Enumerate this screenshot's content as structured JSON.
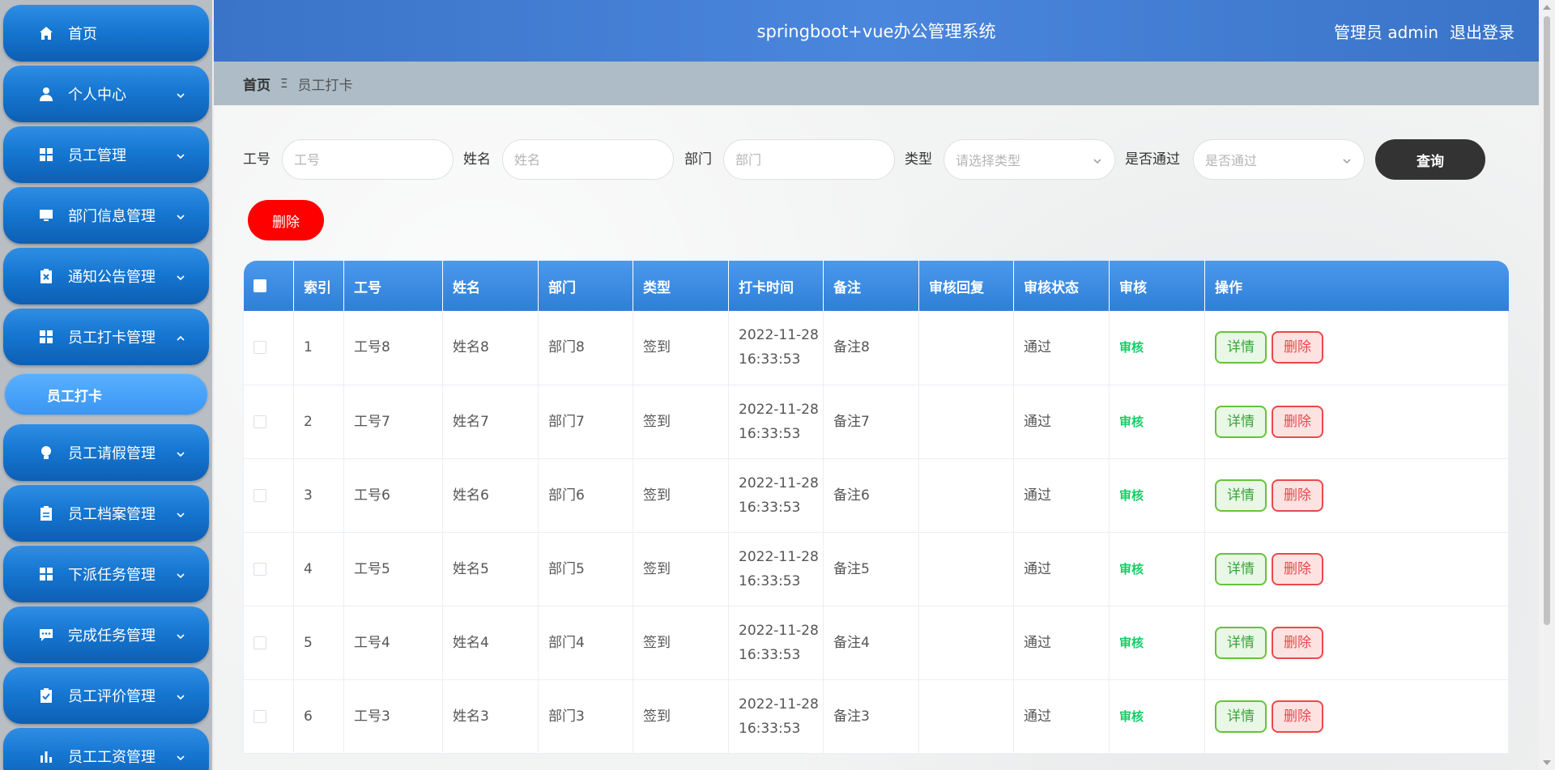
{
  "sidebar": {
    "items": [
      {
        "label": "首页",
        "icon": "home-icon",
        "has_arrow": false
      },
      {
        "label": "个人中心",
        "icon": "user-icon",
        "has_arrow": true,
        "arrow": "chevron-down"
      },
      {
        "label": "员工管理",
        "icon": "grid-icon",
        "has_arrow": true,
        "arrow": "chevron-down"
      },
      {
        "label": "部门信息管理",
        "icon": "monitor-icon",
        "has_arrow": true,
        "arrow": "chevron-down"
      },
      {
        "label": "通知公告管理",
        "icon": "clipboard-x-icon",
        "has_arrow": true,
        "arrow": "chevron-down"
      },
      {
        "label": "员工打卡管理",
        "icon": "grid-icon",
        "has_arrow": true,
        "arrow": "chevron-up"
      },
      {
        "label": "员工请假管理",
        "icon": "lightbulb-icon",
        "has_arrow": true,
        "arrow": "chevron-down"
      },
      {
        "label": "员工档案管理",
        "icon": "clipboard-icon",
        "has_arrow": true,
        "arrow": "chevron-down"
      },
      {
        "label": "下派任务管理",
        "icon": "grid-icon",
        "has_arrow": true,
        "arrow": "chevron-down"
      },
      {
        "label": "完成任务管理",
        "icon": "chat-icon",
        "has_arrow": true,
        "arrow": "chevron-down"
      },
      {
        "label": "员工评价管理",
        "icon": "clipboard-check-icon",
        "has_arrow": true,
        "arrow": "chevron-down"
      },
      {
        "label": "员工工资管理",
        "icon": "bar-chart-icon",
        "has_arrow": true,
        "arrow": "chevron-down"
      }
    ],
    "active_sub": "员工打卡"
  },
  "header": {
    "title": "springboot+vue办公管理系统",
    "user_role": "管理员 admin",
    "logout": "退出登录"
  },
  "breadcrumb": {
    "home": "首页",
    "separator": "Ξ",
    "current": "员工打卡"
  },
  "search": {
    "emp_no_label": "工号",
    "emp_no_placeholder": "工号",
    "name_label": "姓名",
    "name_placeholder": "姓名",
    "dept_label": "部门",
    "dept_placeholder": "部门",
    "type_label": "类型",
    "type_placeholder": "请选择类型",
    "passed_label": "是否通过",
    "passed_placeholder": "是否通过",
    "query_button": "查询"
  },
  "actions": {
    "delete_button": "删除"
  },
  "table": {
    "columns": [
      "",
      "索引",
      "工号",
      "姓名",
      "部门",
      "类型",
      "打卡时间",
      "备注",
      "审核回复",
      "审核状态",
      "审核",
      "操作"
    ],
    "rows": [
      {
        "index": "1",
        "emp_no": "工号8",
        "name": "姓名8",
        "dept": "部门8",
        "type": "签到",
        "date": "2022-11-28",
        "time": "16:33:53",
        "remark": "备注8",
        "reply": "",
        "status": "通过",
        "audit": "审核",
        "detail": "详情",
        "delete": "删除"
      },
      {
        "index": "2",
        "emp_no": "工号7",
        "name": "姓名7",
        "dept": "部门7",
        "type": "签到",
        "date": "2022-11-28",
        "time": "16:33:53",
        "remark": "备注7",
        "reply": "",
        "status": "通过",
        "audit": "审核",
        "detail": "详情",
        "delete": "删除"
      },
      {
        "index": "3",
        "emp_no": "工号6",
        "name": "姓名6",
        "dept": "部门6",
        "type": "签到",
        "date": "2022-11-28",
        "time": "16:33:53",
        "remark": "备注6",
        "reply": "",
        "status": "通过",
        "audit": "审核",
        "detail": "详情",
        "delete": "删除"
      },
      {
        "index": "4",
        "emp_no": "工号5",
        "name": "姓名5",
        "dept": "部门5",
        "type": "签到",
        "date": "2022-11-28",
        "time": "16:33:53",
        "remark": "备注5",
        "reply": "",
        "status": "通过",
        "audit": "审核",
        "detail": "详情",
        "delete": "删除"
      },
      {
        "index": "5",
        "emp_no": "工号4",
        "name": "姓名4",
        "dept": "部门4",
        "type": "签到",
        "date": "2022-11-28",
        "time": "16:33:53",
        "remark": "备注4",
        "reply": "",
        "status": "通过",
        "audit": "审核",
        "detail": "详情",
        "delete": "删除"
      },
      {
        "index": "6",
        "emp_no": "工号3",
        "name": "姓名3",
        "dept": "部门3",
        "type": "签到",
        "date": "2022-11-28",
        "time": "16:33:53",
        "remark": "备注3",
        "reply": "",
        "status": "通过",
        "audit": "审核",
        "detail": "详情",
        "delete": "删除"
      }
    ]
  },
  "colors": {
    "menu_blue": "#1677d2",
    "header_blue": "#4a86dc",
    "delete_red": "#ff0000",
    "query_dark": "#333333",
    "audit_green": "#13ce66"
  }
}
